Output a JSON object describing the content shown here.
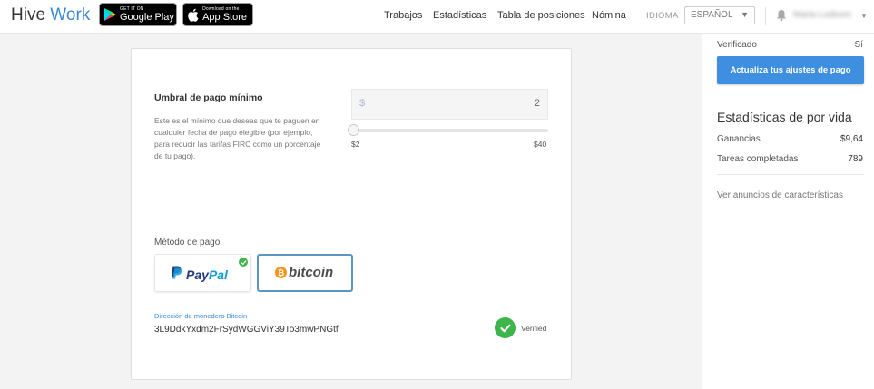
{
  "header": {
    "logo": {
      "hive": "Hive",
      "work": "Work"
    },
    "google_play": {
      "small": "GET IT ON",
      "big": "Google Play"
    },
    "app_store": {
      "small": "Download on the",
      "big": "App Store"
    },
    "nav": [
      "Trabajos",
      "Estadísticas",
      "Tabla de posiciones",
      "Nómina"
    ],
    "idioma_label": "IDIOMA",
    "language": "ESPAÑOL",
    "user_name": "Maria Lodeom"
  },
  "payment": {
    "faded_title": "",
    "umbral_title": "Umbral de pago mínimo",
    "umbral_desc": "Este es el mínimo que deseas que te paguen en cualquier fecha de pago elegible (por ejemplo, para reducir las tarifas FIRC como un porcentaje de tu pago).",
    "currency": "$",
    "amount": "2",
    "slider_min": "$2",
    "slider_max": "$40",
    "slider_level": 0,
    "metodo_label": "Método de pago",
    "paypal": {
      "pay": "Pay",
      "pal": "Pal"
    },
    "bitcoin": {
      "coin": "₿",
      "text": "bitcoin"
    },
    "selected_method": "bitcoin",
    "wallet_label": "Dirección de monedero Bitcoin",
    "wallet_address": "3L9DdkYxdm2FrSydWGGViY39To3mwPNGtf",
    "verified_text": "Verified"
  },
  "sidebar": {
    "verificado_label": "Verificado",
    "verificado_value": "Sí",
    "update_button": "Actualiza tus ajustes de pago",
    "stats_title": "Estadísticas de por vida",
    "stats": [
      {
        "label": "Ganancias",
        "value": "$9,64"
      },
      {
        "label": "Tareas completadas",
        "value": "789"
      }
    ],
    "ver_anuncios": "Ver anuncios de características"
  },
  "colors": {
    "brand_blue": "#3a87d6",
    "button_blue": "#3f8fe0",
    "success_green": "#3cb54a",
    "bitcoin_orange": "#f7931a",
    "paypal_dark": "#253b80",
    "paypal_light": "#179bd7"
  }
}
